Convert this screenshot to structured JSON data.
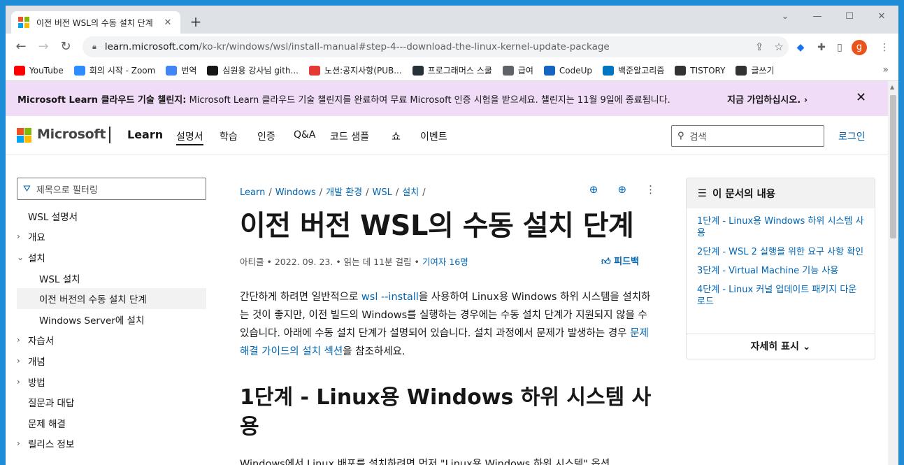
{
  "browser": {
    "tab_title": "이전 버전 WSL의 수동 설치 단계",
    "url_host": "learn.microsoft.com",
    "url_path": "/ko-kr/windows/wsl/install-manual#step-4---download-the-linux-kernel-update-package",
    "profile_initial": "g",
    "bookmarks": [
      {
        "label": "YouTube",
        "color": "#ff0000",
        "icon": "youtube-icon"
      },
      {
        "label": "회의 시작 - Zoom",
        "color": "#2d8cff",
        "icon": "zoom-icon"
      },
      {
        "label": "번역",
        "color": "#4285f4",
        "icon": "translate-icon"
      },
      {
        "label": "심원용 강사님 gith...",
        "color": "#171717",
        "icon": "github-icon"
      },
      {
        "label": "노션:공지사항(PUB...",
        "color": "#e53935",
        "icon": "clock-icon"
      },
      {
        "label": "프로그래머스 스쿨",
        "color": "#263238",
        "icon": "programmers-icon"
      },
      {
        "label": "급여",
        "color": "#5f6368",
        "icon": "globe-icon"
      },
      {
        "label": "CodeUp",
        "color": "#1565c0",
        "icon": "codeup-icon"
      },
      {
        "label": "백준알고리즘",
        "color": "#0076c0",
        "icon": "code-icon"
      },
      {
        "label": "TISTORY",
        "color": "#333333",
        "icon": "tistory-icon"
      },
      {
        "label": "글쓰기",
        "color": "#333333",
        "icon": "tistory-icon"
      }
    ]
  },
  "banner": {
    "bold": "Microsoft Learn 클라우드 기술 챌린지:",
    "text": " Microsoft Learn 클라우드 기술 챌린지를 완료하여 무료 Microsoft 인증 시험을 받으세요. 챌린지는 11월 9일에 종료됩니다.",
    "cta": "지금 가입하십시오."
  },
  "header": {
    "brand": "Microsoft",
    "product": "Learn",
    "nav": [
      "설명서",
      "학습",
      "인증",
      "Q&A",
      "코드 샘플",
      "쇼",
      "이벤트"
    ],
    "search_placeholder": "검색",
    "signin": "로그인"
  },
  "sidebar": {
    "filter_placeholder": "제목으로 필터링",
    "items": [
      {
        "label": "WSL 설명서",
        "chev": "",
        "indent": 0
      },
      {
        "label": "개요",
        "chev": "›",
        "indent": 0
      },
      {
        "label": "설치",
        "chev": "⌄",
        "indent": 0
      },
      {
        "label": "WSL 설치",
        "chev": "",
        "indent": 1
      },
      {
        "label": "이전 버전의 수동 설치 단계",
        "chev": "",
        "indent": 1
      },
      {
        "label": "Windows Server에 설치",
        "chev": "",
        "indent": 1
      },
      {
        "label": "자습서",
        "chev": "›",
        "indent": 0
      },
      {
        "label": "개념",
        "chev": "›",
        "indent": 0
      },
      {
        "label": "방법",
        "chev": "›",
        "indent": 0
      },
      {
        "label": "질문과 대답",
        "chev": "",
        "indent": 0
      },
      {
        "label": "문제 해결",
        "chev": "",
        "indent": 0
      },
      {
        "label": "릴리스 정보",
        "chev": "›",
        "indent": 0
      }
    ]
  },
  "main": {
    "breadcrumb": [
      "Learn",
      "Windows",
      "개발 환경",
      "WSL",
      "설치"
    ],
    "title": "이전 버전 WSL의 수동 설치 단계",
    "meta_type": "아티클",
    "meta_date": "2022. 09. 23.",
    "meta_read": "읽는 데 11분 걸림",
    "meta_contrib": "기여자 16명",
    "feedback": "피드백",
    "p1_a": "간단하게 하려면 일반적으로 ",
    "p1_link": "wsl --install",
    "p1_b": "을 사용하여 Linux용 Windows 하위 시스템을 설치하는 것이 좋지만, 이전 빌드의 Windows를 실행하는 경우에는 수동 설치 단계가 지원되지 않을 수 있습니다. 아래에 수동 설치 단계가 설명되어 있습니다. 설치 과정에서 문제가 발생하는 경우 ",
    "p1_link2": "문제 해결 가이드의 설치 섹션",
    "p1_c": "을 참조하세요.",
    "h2": "1단계 - Linux용 Windows 하위 시스템 사용",
    "p2": "Windows에서 Linux 배포를 설치하려면 먼저 \"Linux용 Windows 하위 시스템\" 옵션"
  },
  "right_toc": {
    "title": "이 문서의 내용",
    "links": [
      "1단계 - Linux용 Windows 하위 시스템 사용",
      "2단계 - WSL 2 실행을 위한 요구 사항 확인",
      "3단계 - Virtual Machine 기능 사용",
      "4단계 - Linux 커널 업데이트 패키지 다운로드"
    ],
    "more": "자세히 표시"
  }
}
